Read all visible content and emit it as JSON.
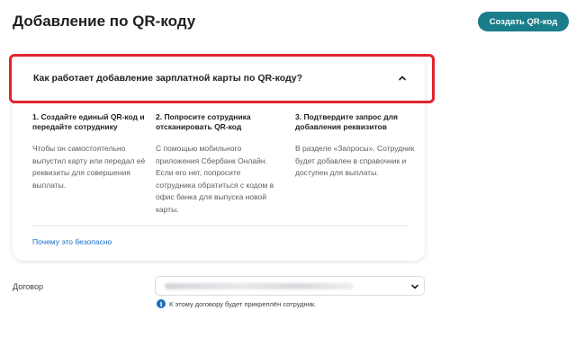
{
  "header": {
    "title": "Добавление по QR-коду",
    "create_button_label": "Создать QR-код"
  },
  "accordion": {
    "title": "Как работает добавление зарплатной карты по QR-коду?",
    "expanded": true,
    "steps": [
      {
        "title": "1. Создайте единый QR-код и передайте сотруднику",
        "text": "Чтобы он самостоятельно выпустил карту или передал её реквизиты для совершения выплаты."
      },
      {
        "title": "2. Попросите сотрудника отсканировать QR-код",
        "text": "С помощью мобильного приложения Сбербанк Онлайн. Если его нет, попросите сотрудника обратиться с кодом в офис банка для выпуска новой карты."
      },
      {
        "title": "3. Подтвердите запрос для добавления реквизитов",
        "text": "В разделе «Запросы». Сотрудник будет добавлен в справочник и доступен для выплаты."
      }
    ],
    "safety_link": "Почему это безопасно"
  },
  "contract": {
    "label": "Договор",
    "hint": "К этому договору будет прикреплён сотрудник."
  },
  "colors": {
    "accent": "#1a7d8a",
    "link": "#1a6dc0",
    "highlight": "#e0232c"
  }
}
